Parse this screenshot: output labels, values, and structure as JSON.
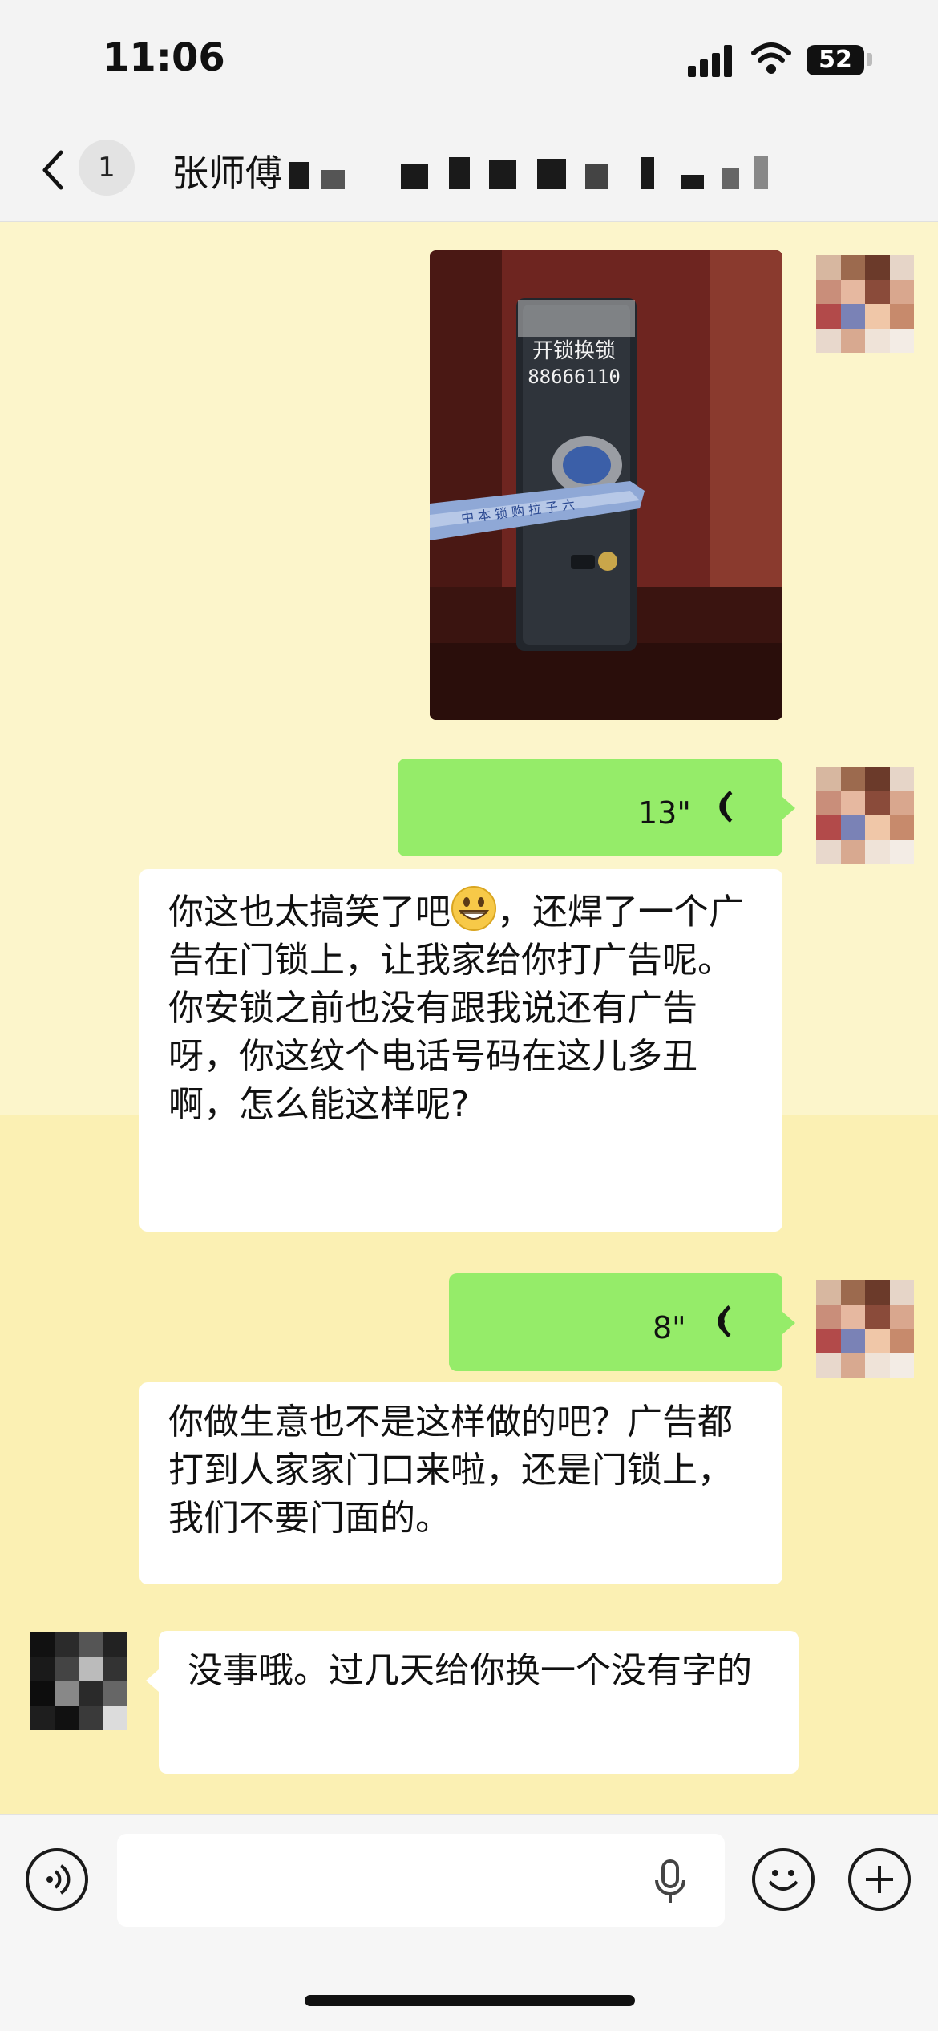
{
  "status_bar": {
    "time": "11:06",
    "battery": "52"
  },
  "nav": {
    "unread_count": "1",
    "title": "张师傅"
  },
  "photo": {
    "sticker_line1": "开锁换锁",
    "sticker_line2": "88666110",
    "handle_scribble": "中 本 锁 购 拉 子 六"
  },
  "messages": [
    {
      "type": "voice",
      "side": "out",
      "duration": "13\""
    },
    {
      "type": "text",
      "side": "in",
      "text_before_emoji": "你这也太搞笑了吧",
      "emoji": "grinning-face",
      "text_after_emoji": "，还焊了一个广告在门锁上，让我家给你打广告呢。你安锁之前也没有跟我说还有广告呀，你这纹个电话号码在这儿多丑啊，怎么能这样呢?"
    },
    {
      "type": "voice",
      "side": "out",
      "duration": "8\""
    },
    {
      "type": "text",
      "side": "in",
      "text": "你做生意也不是这样做的吧？广告都打到人家家门口来啦，还是门锁上，我们不要门面的。"
    },
    {
      "type": "text",
      "side": "peer",
      "text": "没事哦。过几天给你换一个没有字的"
    }
  ],
  "input_bar": {
    "placeholder": "",
    "value": ""
  },
  "colors": {
    "outgoing_bubble": "#95ec69",
    "incoming_bubble": "#ffffff",
    "chat_background": "#fcf5cb"
  },
  "icons": [
    "back-chevron-icon",
    "voice-mode-icon",
    "microphone-icon",
    "emoji-icon",
    "plus-icon"
  ]
}
